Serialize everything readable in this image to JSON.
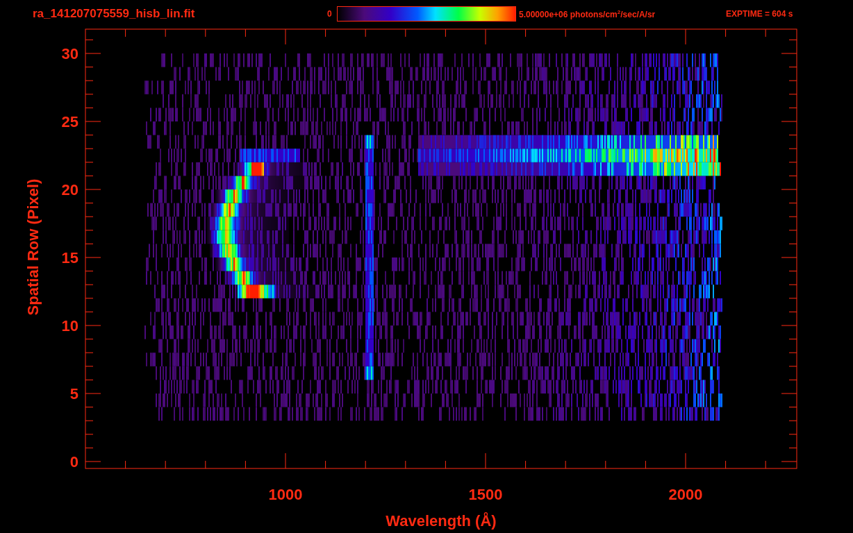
{
  "header": {
    "filename": "ra_141207075559_hisb_lin.fit",
    "colorbar": {
      "min_label": "0",
      "max_label": "5.00000e+06 photons/cm$^{2}$/sec/A/sr"
    },
    "exptime": "EXPTIME = 604 s"
  },
  "plot": {
    "xlabel": "Wavelength (Å)",
    "ylabel": "Spatial Row (Pixel)",
    "xticks": [
      "1000",
      "1500",
      "2000"
    ],
    "yticks": [
      "30",
      "25",
      "20",
      "15",
      "10",
      "5",
      "0"
    ]
  }
}
